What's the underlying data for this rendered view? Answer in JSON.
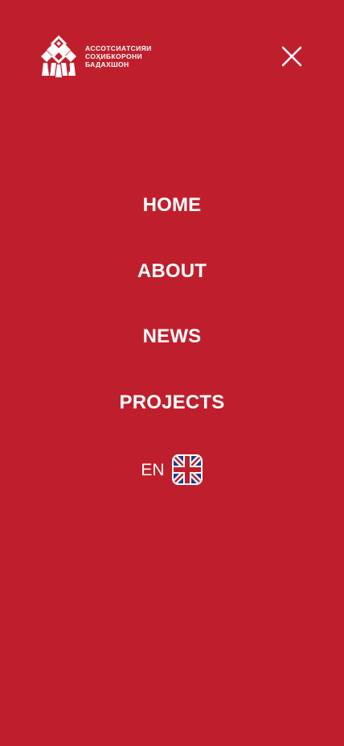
{
  "brand": {
    "name_lines": [
      "АССОТСИАТСИЯИ",
      "СОҲИБКОРОНИ",
      "БАДАХШОН"
    ],
    "logo_icon": "ornamental-diamond-logo"
  },
  "header": {
    "close_icon": "close-icon"
  },
  "menu": {
    "items": [
      {
        "label": "HOME"
      },
      {
        "label": "ABOUT"
      },
      {
        "label": "NEWS"
      },
      {
        "label": "PROJECTS"
      }
    ]
  },
  "language": {
    "code": "EN",
    "flag_icon": "uk-flag-icon"
  },
  "colors": {
    "background": "#bf1f2c",
    "foreground": "#ffffff",
    "flag_blue": "#1d3a8a"
  }
}
